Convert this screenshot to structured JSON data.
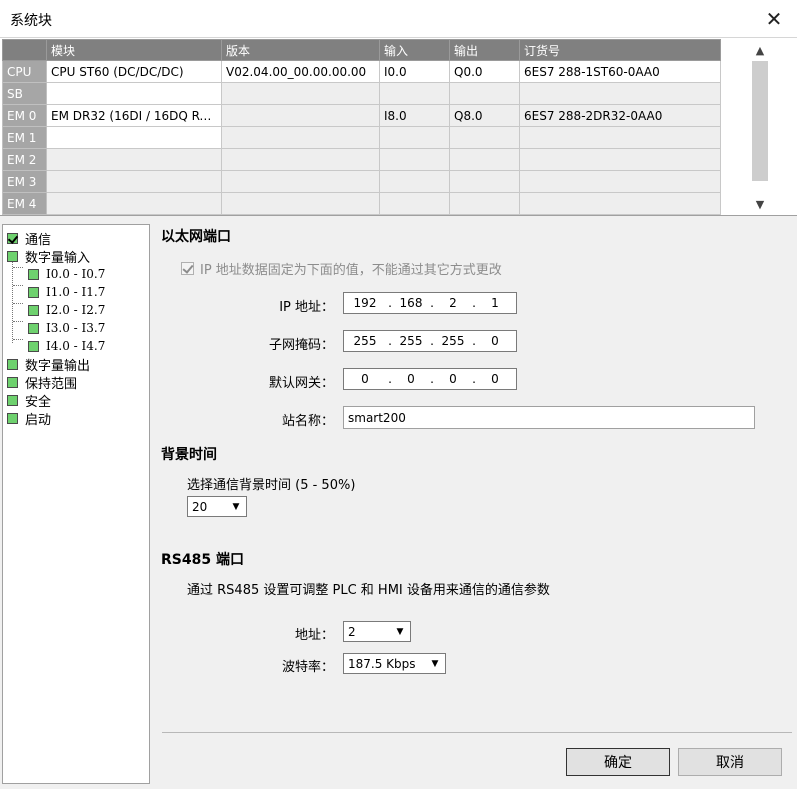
{
  "window": {
    "title": "系统块",
    "close_glyph": "✕"
  },
  "module_table": {
    "headers": [
      "",
      "模块",
      "版本",
      "输入",
      "输出",
      "订货号"
    ],
    "rows": [
      {
        "slot": "CPU",
        "module": "CPU ST60 (DC/DC/DC)",
        "version": "V02.04.00_00.00.00.00",
        "input": "I0.0",
        "output": "Q0.0",
        "order": "6ES7 288-1ST60-0AA0"
      },
      {
        "slot": "SB",
        "module": "",
        "version": "",
        "input": "",
        "output": "",
        "order": ""
      },
      {
        "slot": "EM 0",
        "module": "EM DR32 (16DI / 16DQ Re...",
        "version": "",
        "input": "I8.0",
        "output": "Q8.0",
        "order": "6ES7 288-2DR32-0AA0"
      },
      {
        "slot": "EM 1",
        "module": "",
        "version": "",
        "input": "",
        "output": "",
        "order": ""
      },
      {
        "slot": "EM 2",
        "module": "",
        "version": "",
        "input": "",
        "output": "",
        "order": ""
      },
      {
        "slot": "EM 3",
        "module": "",
        "version": "",
        "input": "",
        "output": "",
        "order": ""
      },
      {
        "slot": "EM 4",
        "module": "",
        "version": "",
        "input": "",
        "output": "",
        "order": ""
      }
    ]
  },
  "tree": {
    "items": [
      {
        "label": "通信"
      },
      {
        "label": "数字量输入"
      },
      {
        "label": "I0.0 - I0.7"
      },
      {
        "label": "I1.0 - I1.7"
      },
      {
        "label": "I2.0 - I2.7"
      },
      {
        "label": "I3.0 - I3.7"
      },
      {
        "label": "I4.0 - I4.7"
      },
      {
        "label": "数字量输出"
      },
      {
        "label": "保持范围"
      },
      {
        "label": "安全"
      },
      {
        "label": "启动"
      }
    ]
  },
  "ethernet": {
    "title": "以太网端口",
    "fixed_ip_label": "IP 地址数据固定为下面的值，不能通过其它方式更改",
    "ip_label": "IP 地址：",
    "ip": [
      "192",
      "168",
      "2",
      "1"
    ],
    "subnet_label": "子网掩码：",
    "subnet": [
      "255",
      "255",
      "255",
      "0"
    ],
    "gateway_label": "默认网关：",
    "gateway": [
      "0",
      "0",
      "0",
      "0"
    ],
    "station_label": "站名称：",
    "station_name": "smart200"
  },
  "background_time": {
    "title": "背景时间",
    "select_label": "选择通信背景时间 (5 - 50%)",
    "value": "20"
  },
  "rs485": {
    "title": "RS485 端口",
    "description": "通过 RS485 设置可调整 PLC 和 HMI 设备用来通信的通信参数",
    "address_label": "地址：",
    "address_value": "2",
    "baud_label": "波特率：",
    "baud_value": "187.5 Kbps"
  },
  "buttons": {
    "ok": "确定",
    "cancel": "取消"
  },
  "colors": {
    "header_bg": "#808080",
    "rowhead_bg": "#a6a6a6",
    "tree_check": "#6ed16e"
  }
}
